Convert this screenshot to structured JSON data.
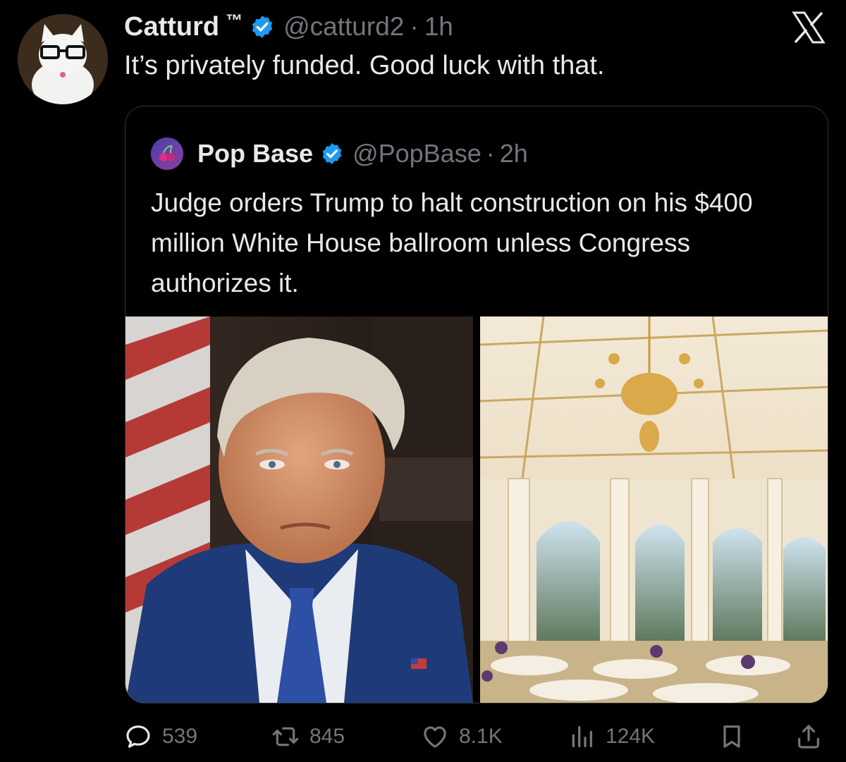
{
  "tweet": {
    "author_name": "Catturd",
    "trademark": "™",
    "handle": "@catturd2",
    "separator": "·",
    "time": "1h",
    "text": "It’s privately funded. Good luck with that."
  },
  "quoted_tweet": {
    "author_name": "Pop Base",
    "handle": "@PopBase",
    "separator": "·",
    "time": "2h",
    "text": "Judge orders Trump to halt construction on his $400 million White House ballroom unless Congress authorizes it."
  },
  "metrics": {
    "replies": "539",
    "reposts": "845",
    "likes": "8.1K",
    "views": "124K"
  },
  "colors": {
    "background": "#000000",
    "text_primary": "#e7e9ea",
    "text_secondary": "#71767b",
    "verified_blue": "#1d9bf0",
    "border": "#2f3336"
  },
  "icons": {
    "brand": "x-logo-icon",
    "verified": "verified-badge-icon",
    "reply": "reply-icon",
    "repost": "repost-icon",
    "like": "heart-icon",
    "views": "views-icon",
    "bookmark": "bookmark-icon",
    "share": "share-icon"
  }
}
